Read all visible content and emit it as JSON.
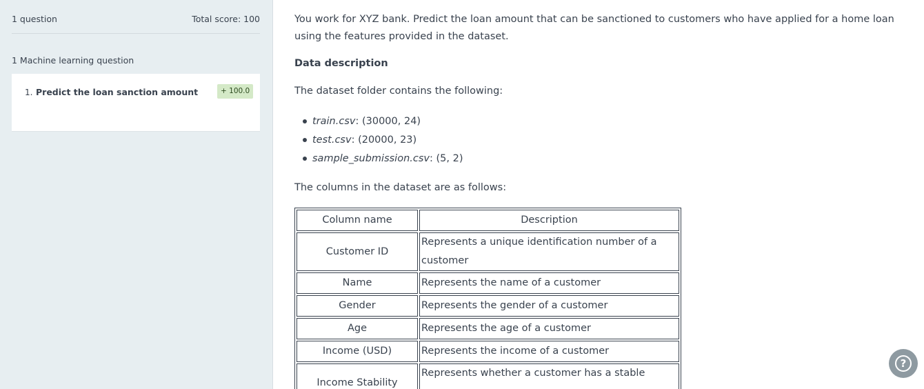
{
  "sidebar": {
    "question_count": "1 question",
    "total_score": "Total score: 100",
    "section_label": "1 Machine learning question",
    "questions": [
      {
        "number": "1.",
        "title": "Predict the loan sanction amount",
        "score": "+ 100.0"
      }
    ]
  },
  "content": {
    "intro": "You work for XYZ bank. Predict the loan amount that can be sanctioned to customers who have applied for a home loan using the features provided in the dataset.",
    "data_heading": "Data description",
    "folder_text": "The dataset folder contains the following:",
    "files": [
      {
        "name": "train.csv",
        "shape": ": (30000, 24)"
      },
      {
        "name": "test.csv",
        "shape": ": (20000, 23)"
      },
      {
        "name": "sample_submission.csv",
        "shape": ": (5, 2)"
      }
    ],
    "columns_text": "The columns in the dataset are as follows:",
    "table": {
      "headers": [
        "Column name",
        "Description"
      ],
      "rows": [
        [
          "Customer ID",
          "Represents a unique identification number of a customer"
        ],
        [
          "Name",
          "Represents the name of a customer"
        ],
        [
          "Gender",
          "Represents the gender of a customer"
        ],
        [
          "Age",
          "Represents the age of a customer"
        ],
        [
          "Income (USD)",
          "Represents the income of a customer"
        ],
        [
          "Income Stability",
          "Represents whether a customer has a stable source"
        ]
      ]
    }
  },
  "help": {
    "icon": "question-icon",
    "glyph": "?"
  }
}
